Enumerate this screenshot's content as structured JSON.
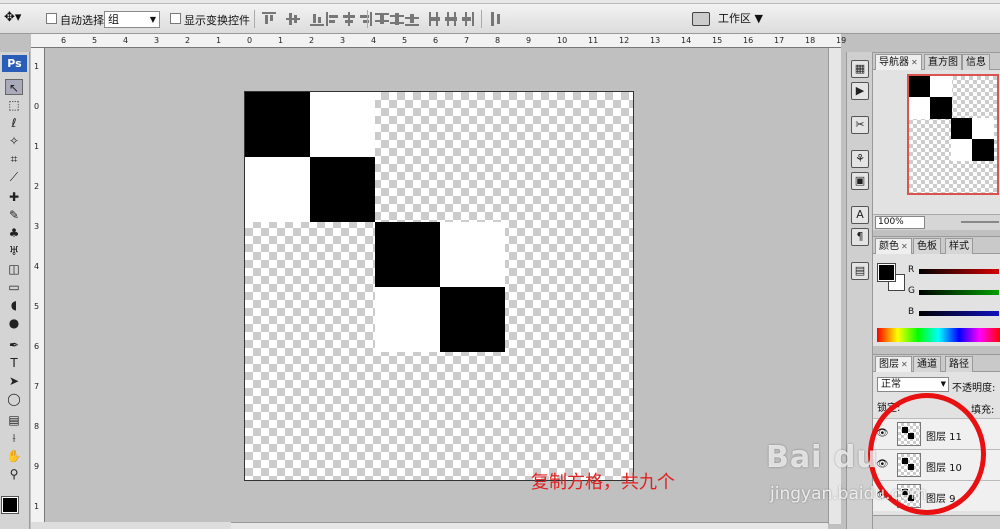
{
  "options_bar": {
    "auto_select_label": "自动选择:",
    "auto_select_value": "组",
    "show_transform_label": "显示变换控件",
    "workspace_label": "工作区"
  },
  "toolbox": {
    "logo": "Ps"
  },
  "rulers": {
    "top_ticks": [
      "6",
      "5",
      "4",
      "3",
      "2",
      "1",
      "0",
      "1",
      "2",
      "3",
      "4",
      "5",
      "6",
      "7",
      "8",
      "9",
      "10",
      "11",
      "12",
      "13",
      "14",
      "15",
      "16",
      "17",
      "18",
      "19"
    ],
    "left_ticks": [
      "1",
      "0",
      "1",
      "2",
      "3",
      "4",
      "5",
      "6",
      "7",
      "8",
      "9",
      "1"
    ]
  },
  "canvas": {
    "grid": [
      [
        "black",
        "white",
        "",
        "",
        "",
        "",
        ""
      ],
      [
        "white",
        "black",
        "",
        "",
        "",
        "",
        ""
      ],
      [
        "",
        "",
        "black",
        "white",
        "",
        "",
        ""
      ],
      [
        "",
        "",
        "white",
        "black",
        "",
        "",
        ""
      ]
    ]
  },
  "annotation": "复制方格，共九个",
  "navigator_panel": {
    "tabs": [
      "导航器",
      "直方图",
      "信息"
    ],
    "zoom": "100%"
  },
  "color_panel": {
    "tabs": [
      "颜色",
      "色板",
      "样式"
    ],
    "channels": [
      {
        "label": "R",
        "color": "#d40000"
      },
      {
        "label": "G",
        "color": "#00a000"
      },
      {
        "label": "B",
        "color": "#1010c0"
      }
    ]
  },
  "layers_panel": {
    "tabs": [
      "图层",
      "通道",
      "路径"
    ],
    "blend_mode": "正常",
    "opacity_label": "不透明度:",
    "lock_label": "锁定:",
    "fill_label": "填充:",
    "layers": [
      {
        "name": "图层 11"
      },
      {
        "name": "图层 10"
      },
      {
        "name": "图层 9"
      }
    ]
  },
  "watermark": {
    "brand": "Bai du",
    "site": "jingyan.baidu.com"
  }
}
